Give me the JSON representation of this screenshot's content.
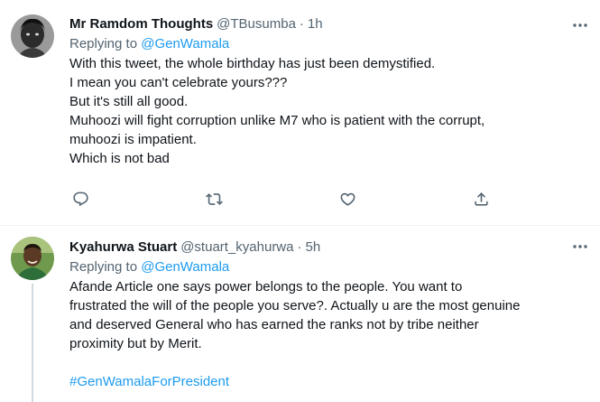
{
  "tweets": [
    {
      "display_name": "Mr Ramdom Thoughts",
      "handle": "@TBusumba",
      "separator": "·",
      "time": "1h",
      "replying_prefix": "Replying to",
      "replying_to": "@GenWamala",
      "lines": [
        "With this tweet, the whole birthday has just been demystified.",
        "I mean you can't celebrate yours???",
        "But it's still all good.",
        "Muhoozi will fight corruption unlike M7 who is patient with the corrupt,",
        "muhoozi is impatient.",
        "Which is not bad"
      ],
      "actions": [
        "reply-icon",
        "retweet-icon",
        "like-icon",
        "share-icon"
      ]
    },
    {
      "display_name": "Kyahurwa Stuart",
      "handle": "@stuart_kyahurwa",
      "separator": "·",
      "time": "5h",
      "replying_prefix": "Replying to",
      "replying_to": "@GenWamala",
      "lines": [
        "Afande Article one says power belongs to the people. You want to",
        "frustrated the will of the people you serve?. Actually u are the most genuine",
        "and deserved General who has earned the ranks not by tribe neither",
        "proximity but by Merit."
      ],
      "hashtag": "#GenWamalaForPresident"
    }
  ],
  "colors": {
    "link": "#1d9bf0",
    "secondary_text": "#536471",
    "primary_text": "#0f1419",
    "divider": "#eff3f4"
  }
}
